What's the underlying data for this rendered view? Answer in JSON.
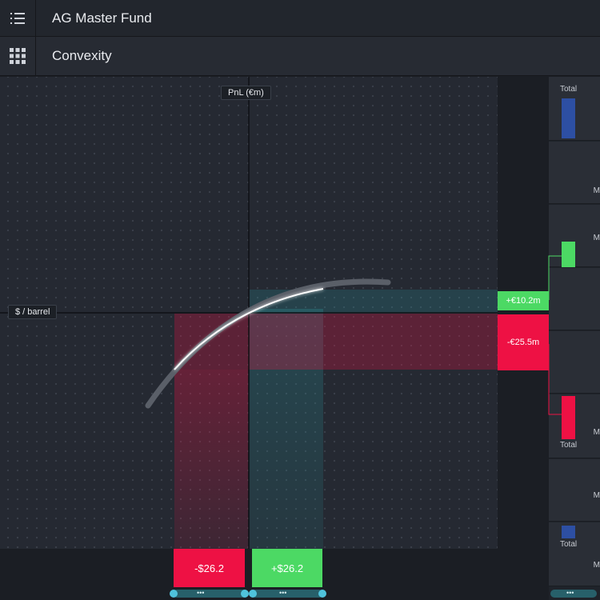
{
  "header": {
    "fund_title": "AG Master Fund",
    "menu_icon": "list-icon"
  },
  "subheader": {
    "view_title": "Convexity",
    "grid_icon": "apps-grid-icon"
  },
  "chart": {
    "y_axis_label": "PnL (€m)",
    "x_axis_label": "$ / barrel",
    "pnl_up": "+€10.2m",
    "pnl_down": "-€25.5m",
    "price_down": "-$26.2",
    "price_up": "+$26.2",
    "colors": {
      "gain": "#4cd964",
      "loss": "#ee1144",
      "teal": "#3aa8b0",
      "curve": "#ffffff"
    }
  },
  "side_panel": {
    "total_top": "Total",
    "m1": "M",
    "m2": "M",
    "m3": "M",
    "total_mid": "Total",
    "m4": "M",
    "total_bottom": "Total",
    "m5": "M"
  },
  "scrubber": {
    "dots": "•••"
  }
}
